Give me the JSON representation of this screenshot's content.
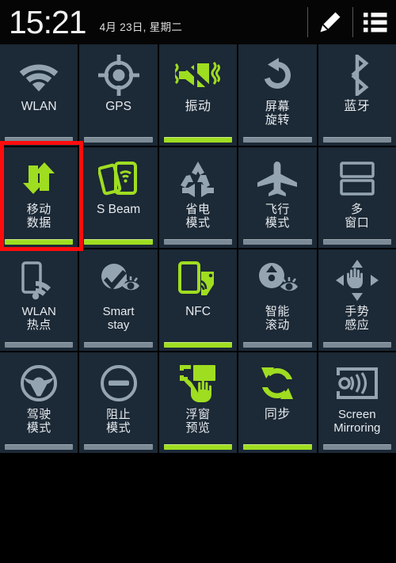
{
  "statusbar": {
    "time": "15:21",
    "date": "4月 23日, 星期二",
    "icons": [
      {
        "name": "pencil-edit-icon",
        "label": "edit"
      },
      {
        "name": "list-menu-icon",
        "label": "list"
      }
    ]
  },
  "colors": {
    "accent_green": "#9fdd21",
    "tile_background": "#1c2936",
    "inactive_bar": "#7b8a95",
    "highlight_red": "#fb0d0d",
    "icon_gray": "#94a5b1",
    "text": "#e6eaee"
  },
  "highlight": {
    "target": "移动数据",
    "note": "red selection rectangle around mobile-data tile"
  },
  "quick_settings": {
    "rows": 4,
    "columns": 5,
    "tiles": [
      {
        "id": "wlan",
        "label": "WLAN",
        "lines": [
          "WLAN"
        ],
        "icon": "wifi-icon",
        "active": false
      },
      {
        "id": "gps",
        "label": "GPS",
        "lines": [
          "GPS"
        ],
        "icon": "gps-crosshair-icon",
        "active": false
      },
      {
        "id": "vibration",
        "label": "振动",
        "lines": [
          "振动"
        ],
        "icon": "vibrate-mute-icon",
        "active": true
      },
      {
        "id": "screen-rotation",
        "label": "屏幕旋转",
        "lines": [
          "屏幕",
          "旋转"
        ],
        "icon": "rotate-icon",
        "active": false
      },
      {
        "id": "bluetooth",
        "label": "蓝牙",
        "lines": [
          "蓝牙"
        ],
        "icon": "bluetooth-icon",
        "active": false
      },
      {
        "id": "mobile-data",
        "label": "移动数据",
        "lines": [
          "移动",
          "数据"
        ],
        "icon": "data-arrows-icon",
        "active": true
      },
      {
        "id": "s-beam",
        "label": "S Beam",
        "lines": [
          "S Beam"
        ],
        "icon": "s-beam-icon",
        "active": true
      },
      {
        "id": "power-saving",
        "label": "省电模式",
        "lines": [
          "省电",
          "模式"
        ],
        "icon": "recycle-icon",
        "active": false
      },
      {
        "id": "airplane-mode",
        "label": "飞行模式",
        "lines": [
          "飞行",
          "模式"
        ],
        "icon": "airplane-icon",
        "active": false
      },
      {
        "id": "multi-window",
        "label": "多窗口",
        "lines": [
          "多",
          "窗口"
        ],
        "icon": "multi-window-icon",
        "active": false
      },
      {
        "id": "wlan-hotspot",
        "label": "WLAN热点",
        "lines": [
          "WLAN",
          "热点"
        ],
        "icon": "hotspot-icon",
        "active": false
      },
      {
        "id": "smart-stay",
        "label": "Smart stay",
        "lines": [
          "Smart",
          "stay"
        ],
        "icon": "smart-stay-icon",
        "active": false
      },
      {
        "id": "nfc",
        "label": "NFC",
        "lines": [
          "NFC"
        ],
        "icon": "nfc-icon",
        "active": true
      },
      {
        "id": "smart-scroll",
        "label": "智能滚动",
        "lines": [
          "智能",
          "滚动"
        ],
        "icon": "smart-scroll-icon",
        "active": false
      },
      {
        "id": "gesture-sensing",
        "label": "手势感应",
        "lines": [
          "手势",
          "感应"
        ],
        "icon": "gesture-hand-icon",
        "active": false
      },
      {
        "id": "driving-mode",
        "label": "驾驶模式",
        "lines": [
          "驾驶",
          "模式"
        ],
        "icon": "steering-wheel-icon",
        "active": false
      },
      {
        "id": "blocking-mode",
        "label": "阻止模式",
        "lines": [
          "阻止",
          "模式"
        ],
        "icon": "blocking-circle-icon",
        "active": false
      },
      {
        "id": "floating-preview",
        "label": "浮窗预览",
        "lines": [
          "浮窗",
          "预览"
        ],
        "icon": "floating-preview-icon",
        "active": true
      },
      {
        "id": "sync",
        "label": "同步",
        "lines": [
          "同步"
        ],
        "icon": "sync-icon",
        "active": true
      },
      {
        "id": "screen-mirroring",
        "label": "Screen Mirroring",
        "lines": [
          "Screen",
          "Mirroring"
        ],
        "icon": "screen-mirroring-icon",
        "active": false
      }
    ]
  }
}
